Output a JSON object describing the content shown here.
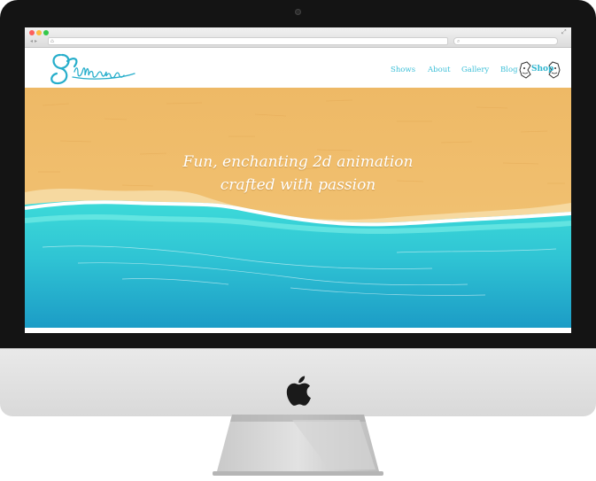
{
  "browser": {
    "url": "",
    "search": ""
  },
  "site": {
    "logo_text": "Pullmation",
    "nav": [
      {
        "label": "Shows"
      },
      {
        "label": "About"
      },
      {
        "label": "Gallery"
      },
      {
        "label": "Blog"
      },
      {
        "label": "Shop"
      }
    ]
  },
  "hero": {
    "line1": "Fun, enchanting 2d animation",
    "line2": "crafted with passion"
  },
  "colors": {
    "accent": "#3fc0d8",
    "sand": "#f0bd66",
    "sea": "#2ec6d6",
    "deep_sea": "#1e9fc4"
  }
}
